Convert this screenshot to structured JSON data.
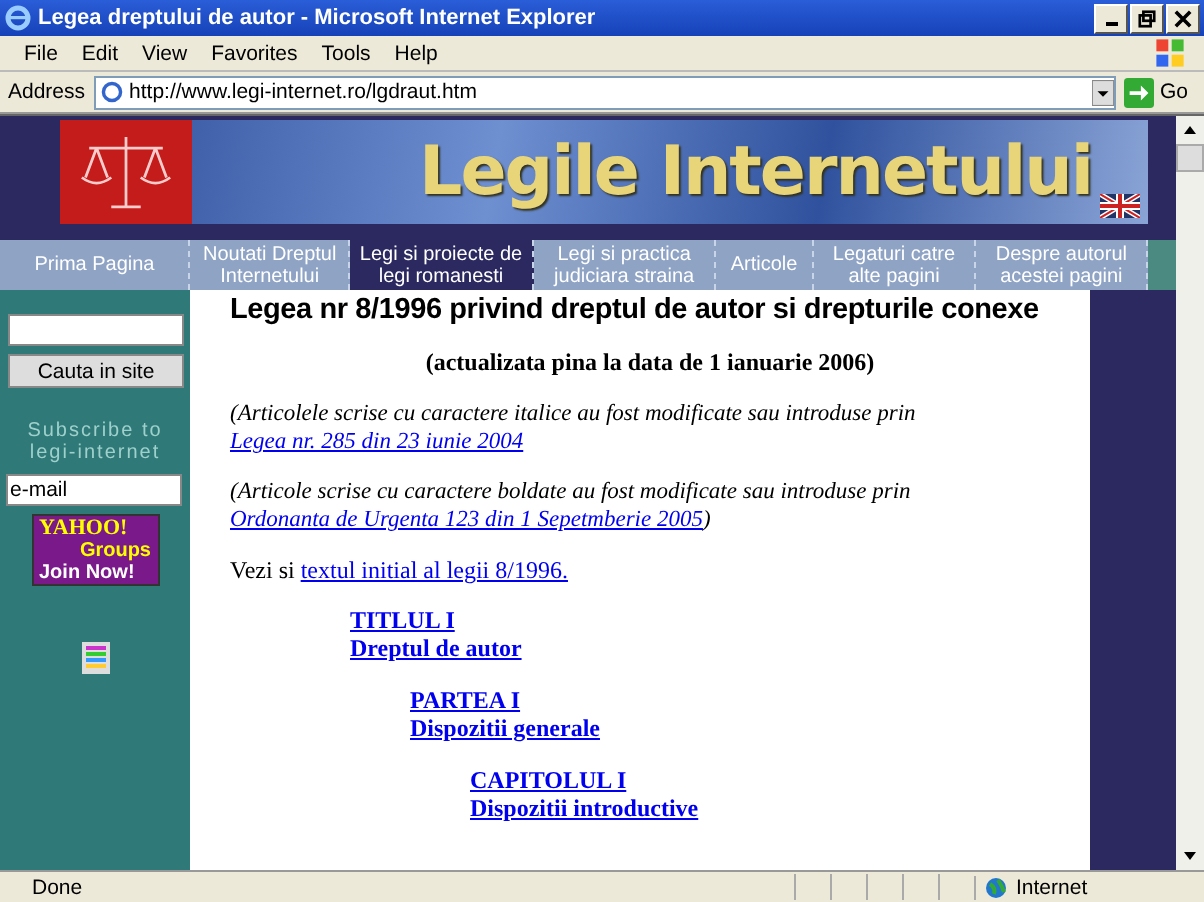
{
  "window": {
    "title": "Legea dreptului de autor - Microsoft Internet Explorer"
  },
  "menu": [
    "File",
    "Edit",
    "View",
    "Favorites",
    "Tools",
    "Help"
  ],
  "address": {
    "label": "Address",
    "url": "http://www.legi-internet.ro/lgdraut.htm",
    "go": "Go"
  },
  "banner": {
    "title": "Legile Internetului"
  },
  "nav": [
    {
      "label": "Prima Pagina",
      "selected": false
    },
    {
      "label": "Noutati Dreptul Internetului",
      "selected": false
    },
    {
      "label": "Legi si proiecte de legi romanesti",
      "selected": true
    },
    {
      "label": "Legi si practica judiciara straina",
      "selected": false
    },
    {
      "label": "Articole",
      "selected": false
    },
    {
      "label": "Legaturi catre alte pagini",
      "selected": false
    },
    {
      "label": "Despre autorul acestei pagini",
      "selected": false
    }
  ],
  "sidebar": {
    "search_button": "Cauta in site",
    "subscribe": "Subscribe to legi-internet",
    "email_value": "e-mail",
    "yahoo": {
      "logo": "YAHOO!",
      "groups": "Groups",
      "join": "Join Now!"
    }
  },
  "article": {
    "title": "Legea nr 8/1996 privind dreptul de autor si drepturile conexe",
    "subtitle": "(actualizata pina la data de 1 ianuarie 2006)",
    "notes": [
      {
        "text": "(Articolele scrise cu caractere italice au fost modificate sau introduse prin ",
        "link": "Legea nr. 285 din 23 iunie 2004"
      },
      {
        "text": "(Articole scrise cu caractere boldate au fost modificate sau introduse prin ",
        "link": "Ordonanta de Urgenta 123 din 1 Sepetmberie 2005",
        "after": ")"
      }
    ],
    "see_also": {
      "text": "Vezi si ",
      "link": "textul initial al legii 8/1996."
    },
    "outline": [
      {
        "heading": "TITLUL I",
        "subtitle": "Dreptul de autor",
        "children": [
          {
            "heading": "PARTEA I",
            "subtitle": "Dispozitii generale",
            "children": [
              {
                "heading": "CAPITOLUL I",
                "subtitle": "Dispozitii introductive"
              }
            ]
          }
        ]
      }
    ]
  },
  "status_bar": {
    "text": "Done",
    "zone": "Internet"
  }
}
